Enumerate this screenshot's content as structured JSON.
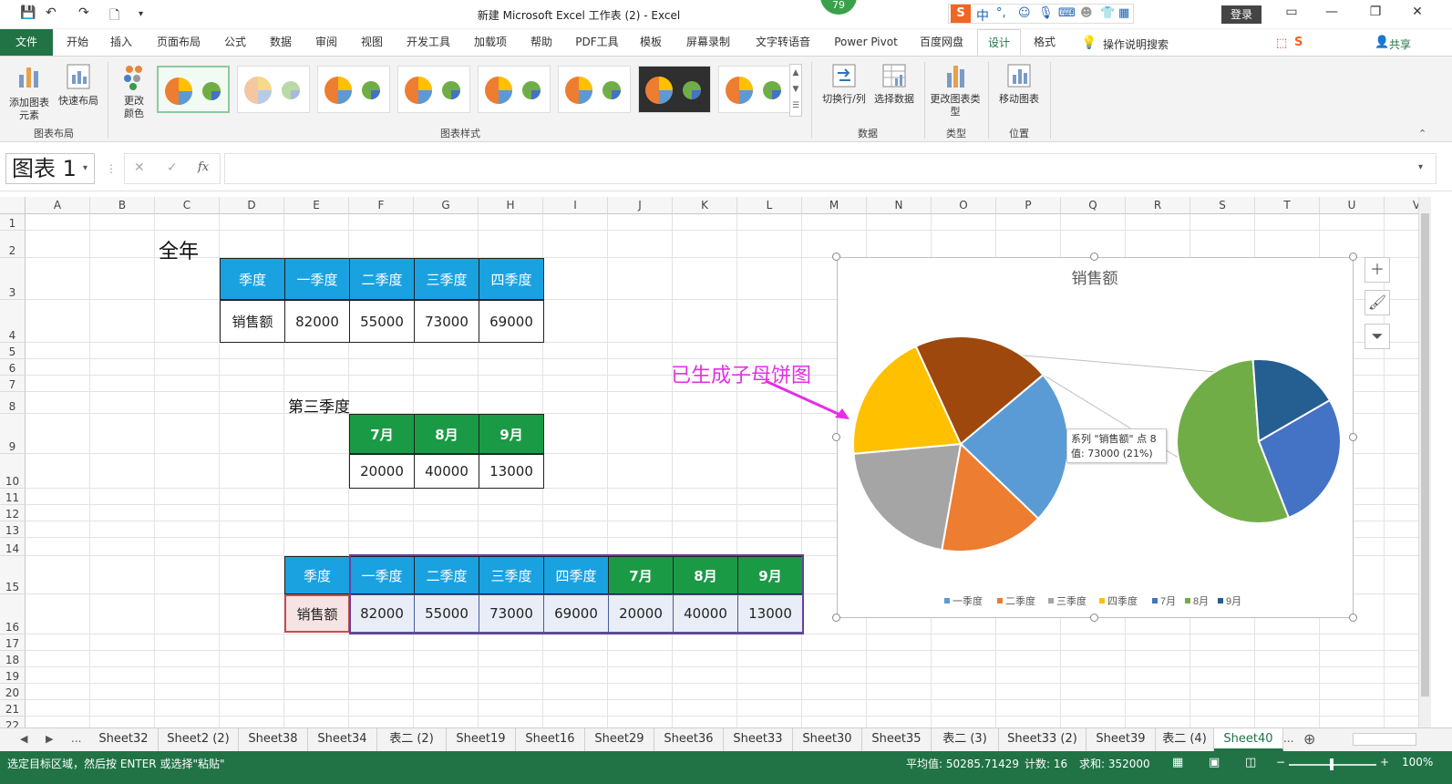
{
  "window": {
    "title": "新建 Microsoft Excel 工作表 (2)  -  Excel",
    "login_label": "登录",
    "badge": "79",
    "ime_label": "中"
  },
  "ribbon_tabs": [
    "文件",
    "开始",
    "插入",
    "页面布局",
    "公式",
    "数据",
    "审阅",
    "视图",
    "开发工具",
    "加载项",
    "帮助",
    "PDF工具",
    "模板",
    "屏幕录制",
    "文字转语音",
    "Power Pivot",
    "百度网盘",
    "设计",
    "格式"
  ],
  "tell_me": "操作说明搜索",
  "share": "共享",
  "ribbon": {
    "add_element": "添加图表元素",
    "quick_layout": "快速布局",
    "change_color": "更改颜色",
    "group_layout": "图表布局",
    "group_styles": "图表样式",
    "switch_rowcol": "切换行/列",
    "select_data": "选择数据",
    "group_data": "数据",
    "change_type": "更改图表类型",
    "group_type": "类型",
    "move_chart": "移动图表",
    "group_location": "位置"
  },
  "formula_bar": {
    "name_box": "图表 1",
    "cancel": "✕",
    "enter": "✓",
    "fx": "fx"
  },
  "columns": [
    "A",
    "B",
    "C",
    "D",
    "E",
    "F",
    "G",
    "H",
    "I",
    "J",
    "K",
    "L",
    "M",
    "N",
    "O",
    "P",
    "Q",
    "R",
    "S",
    "T",
    "U",
    "V"
  ],
  "rows": [
    "1",
    "2",
    "3",
    "4",
    "5",
    "6",
    "7",
    "8",
    "9",
    "10",
    "11",
    "12",
    "13",
    "14",
    "15",
    "16",
    "17",
    "18",
    "19",
    "20",
    "21",
    "22"
  ],
  "sheet": {
    "full_year_label": "全年",
    "q3_label": "第三季度",
    "table1": {
      "headers": [
        "季度",
        "一季度",
        "二季度",
        "三季度",
        "四季度"
      ],
      "values": [
        "销售额",
        "82000",
        "55000",
        "73000",
        "69000"
      ]
    },
    "table2": {
      "headers": [
        "7月",
        "8月",
        "9月"
      ],
      "values": [
        "20000",
        "40000",
        "13000"
      ]
    },
    "table3": {
      "headers": [
        "季度",
        "一季度",
        "二季度",
        "三季度",
        "四季度",
        "7月",
        "8月",
        "9月"
      ],
      "values": [
        "销售额",
        "82000",
        "55000",
        "73000",
        "69000",
        "20000",
        "40000",
        "13000"
      ]
    }
  },
  "annotation": "已生成子母饼图",
  "tooltip": {
    "line1": "系列 \"销售额\" 点 8",
    "line2": "值: 73000 (21%)"
  },
  "chart_data": {
    "type": "pie",
    "title": "销售额",
    "categories": [
      "一季度",
      "二季度",
      "三季度",
      "四季度",
      "7月",
      "8月",
      "9月"
    ],
    "values": [
      82000,
      55000,
      73000,
      69000,
      20000,
      40000,
      13000
    ],
    "colors": [
      "#5b9bd5",
      "#ed7d31",
      "#a5a5a5",
      "#ffc000",
      "#4472c4",
      "#70ad47",
      "#255e91"
    ],
    "main_pie": {
      "labels": [
        "一季度",
        "二季度",
        "三季度",
        "四季度",
        "三季度"
      ],
      "values": [
        82000,
        55000,
        73000,
        69000,
        73000
      ],
      "colors": [
        "#5b9bd5",
        "#ed7d31",
        "#a5a5a5",
        "#ffc000",
        "#9e480e"
      ]
    },
    "sub_pie": {
      "labels": [
        "7月",
        "8月",
        "9月"
      ],
      "values": [
        20000,
        40000,
        13000
      ],
      "colors": [
        "#4472c4",
        "#70ad47",
        "#255e91"
      ]
    },
    "legend_position": "bottom"
  },
  "sheet_tabs": [
    "Sheet32",
    "Sheet2 (2)",
    "Sheet38",
    "Sheet34",
    "表二 (2)",
    "Sheet19",
    "Sheet16",
    "Sheet29",
    "Sheet36",
    "Sheet33",
    "Sheet30",
    "Sheet35",
    "表二 (3)",
    "Sheet33 (2)",
    "Sheet39",
    "表二 (4)",
    "Sheet40"
  ],
  "active_sheet": "Sheet40",
  "status": {
    "message": "选定目标区域，然后按 ENTER 或选择\"粘贴\"",
    "average": "平均值: 50285.71429",
    "count": "计数: 16",
    "sum": "求和: 352000",
    "zoom": "100%"
  }
}
